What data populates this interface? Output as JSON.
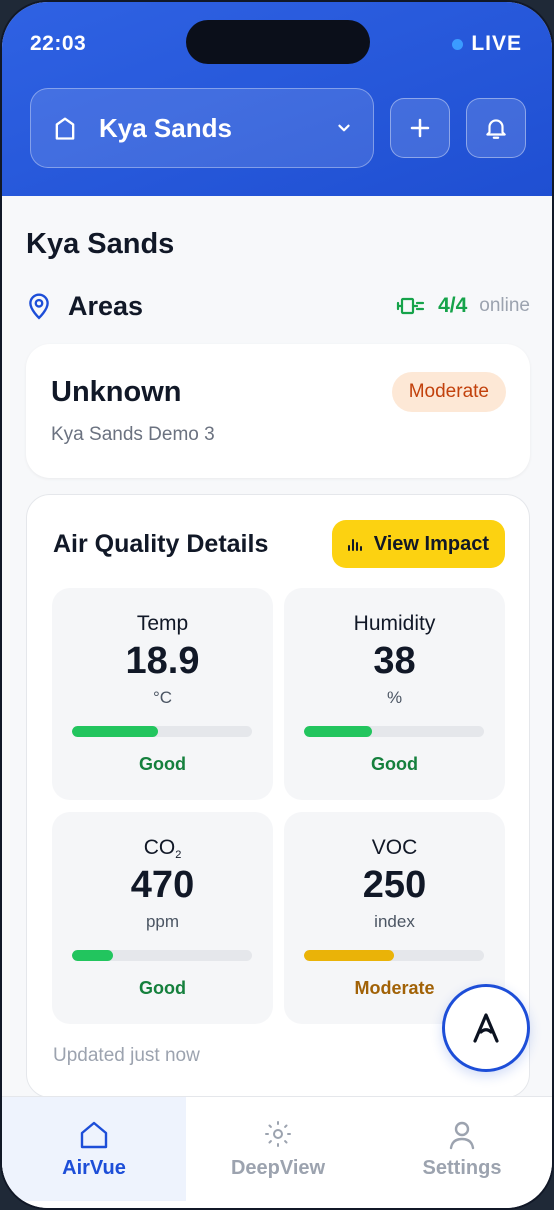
{
  "status": {
    "time": "22:03",
    "live_label": "LIVE"
  },
  "header": {
    "site_name": "Kya Sands"
  },
  "page": {
    "title": "Kya Sands",
    "areas_label": "Areas",
    "device_count": "4/4",
    "online_label": "online"
  },
  "area_card": {
    "name": "Unknown",
    "subtitle": "Kya Sands Demo 3",
    "badge": "Moderate"
  },
  "air_quality": {
    "title": "Air Quality Details",
    "impact_button": "View Impact",
    "updated": "Updated just now",
    "metrics": [
      {
        "label": "Temp",
        "value": "18.9",
        "unit": "°C",
        "status": "Good",
        "level": 0.48,
        "color": "#22c55e",
        "status_color": "#15803d"
      },
      {
        "label": "Humidity",
        "value": "38",
        "unit": "%",
        "status": "Good",
        "level": 0.38,
        "color": "#22c55e",
        "status_color": "#15803d"
      },
      {
        "label": "CO",
        "label_sub": "2",
        "value": "470",
        "unit": "ppm",
        "status": "Good",
        "level": 0.23,
        "color": "#22c55e",
        "status_color": "#15803d"
      },
      {
        "label": "VOC",
        "value": "250",
        "unit": "index",
        "status": "Moderate",
        "level": 0.5,
        "color": "#eab308",
        "status_color": "#a16207"
      }
    ]
  },
  "nav": [
    {
      "label": "AirVue",
      "icon": "home-icon",
      "active": true
    },
    {
      "label": "DeepView",
      "icon": "sun-icon",
      "active": false
    },
    {
      "label": "Settings",
      "icon": "user-icon",
      "active": false
    }
  ],
  "colors": {
    "primary": "#1f4fd2",
    "accent_yellow": "#fcd211",
    "good": "#15803d",
    "moderate": "#c2410c"
  }
}
